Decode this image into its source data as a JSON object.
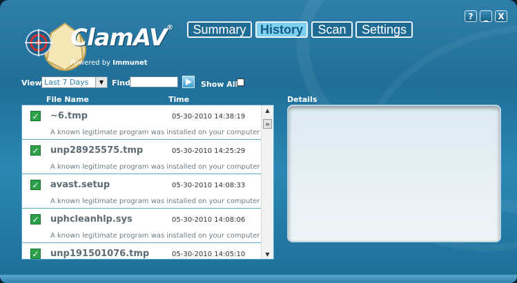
{
  "window_controls": {
    "help": "?",
    "minimize": "_",
    "close": "X"
  },
  "branding": {
    "product": "ClamAV",
    "registered": "®",
    "powered_by": "Powered by",
    "partner": "Immunet"
  },
  "tabs": [
    {
      "label": "Summary",
      "active": false
    },
    {
      "label": "History",
      "active": true
    },
    {
      "label": "Scan",
      "active": false
    },
    {
      "label": "Settings",
      "active": false
    }
  ],
  "toolbar": {
    "view_label": "View",
    "view_selected": "Last 7 Days",
    "find_label": "Find",
    "find_value": "",
    "show_all_label": "Show All",
    "show_all_checked": false
  },
  "list": {
    "col_file": "File Name",
    "col_time": "Time",
    "rows": [
      {
        "file": "~6.tmp",
        "time": "05-30-2010 14:38:19",
        "desc": "A known legitimate program was installed on your computer"
      },
      {
        "file": "unp28925575.tmp",
        "time": "05-30-2010 14:25:29",
        "desc": "A known legitimate program was installed on your computer"
      },
      {
        "file": "avast.setup",
        "time": "05-30-2010 14:08:33",
        "desc": "A known legitimate program was installed on your computer"
      },
      {
        "file": "uphcleanhlp.sys",
        "time": "05-30-2010 14:08:06",
        "desc": "A known legitimate program was installed on your computer"
      },
      {
        "file": "unp191501076.tmp",
        "time": "05-30-2010 14:05:10",
        "desc": ""
      }
    ]
  },
  "details": {
    "label": "Details"
  },
  "colors": {
    "accent": "#7fd0ef",
    "background": "#1f6f99",
    "check": "#2ea04a"
  }
}
